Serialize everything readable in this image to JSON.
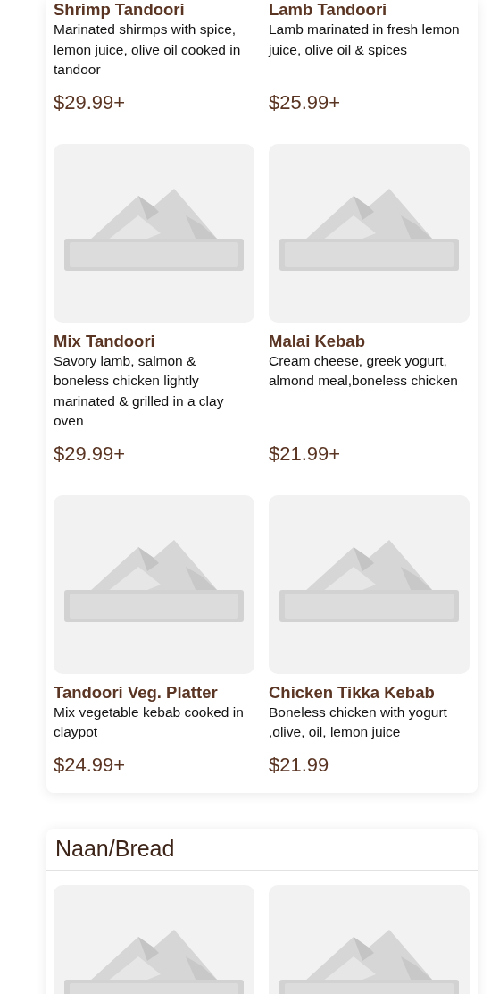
{
  "sections": [
    {
      "items": [
        {
          "name": "Shrimp Tandoori",
          "description": "Marinated shirmps with spice, lemon juice, olive oil cooked in tandoor",
          "price": "$29.99+"
        },
        {
          "name": "Lamb Tandoori",
          "description": "Lamb marinated in fresh lemon juice, olive oil & spices",
          "price": "$25.99+"
        },
        {
          "kind": "picture",
          "name": "Mix Tandoori",
          "description": "Savory lamb, salmon & boneless chicken lightly marinated & grilled in a clay oven",
          "price": "$29.99+"
        },
        {
          "kind": "picture",
          "name": "Malai Kebab",
          "description": "Cream cheese, greek yogurt, almond meal,boneless chicken",
          "price": "$21.99+"
        },
        {
          "kind": "picture",
          "name": "Tandoori Veg. Platter",
          "description": "Mix vegetable kebab cooked in claypot",
          "price": "$24.99+"
        },
        {
          "kind": "picture",
          "name": "Chicken Tikka Kebab",
          "description": "Boneless chicken with yogurt ,olive, oil, lemon juice",
          "price": "$21.99"
        }
      ]
    },
    {
      "title": "Naan/Bread"
    }
  ]
}
